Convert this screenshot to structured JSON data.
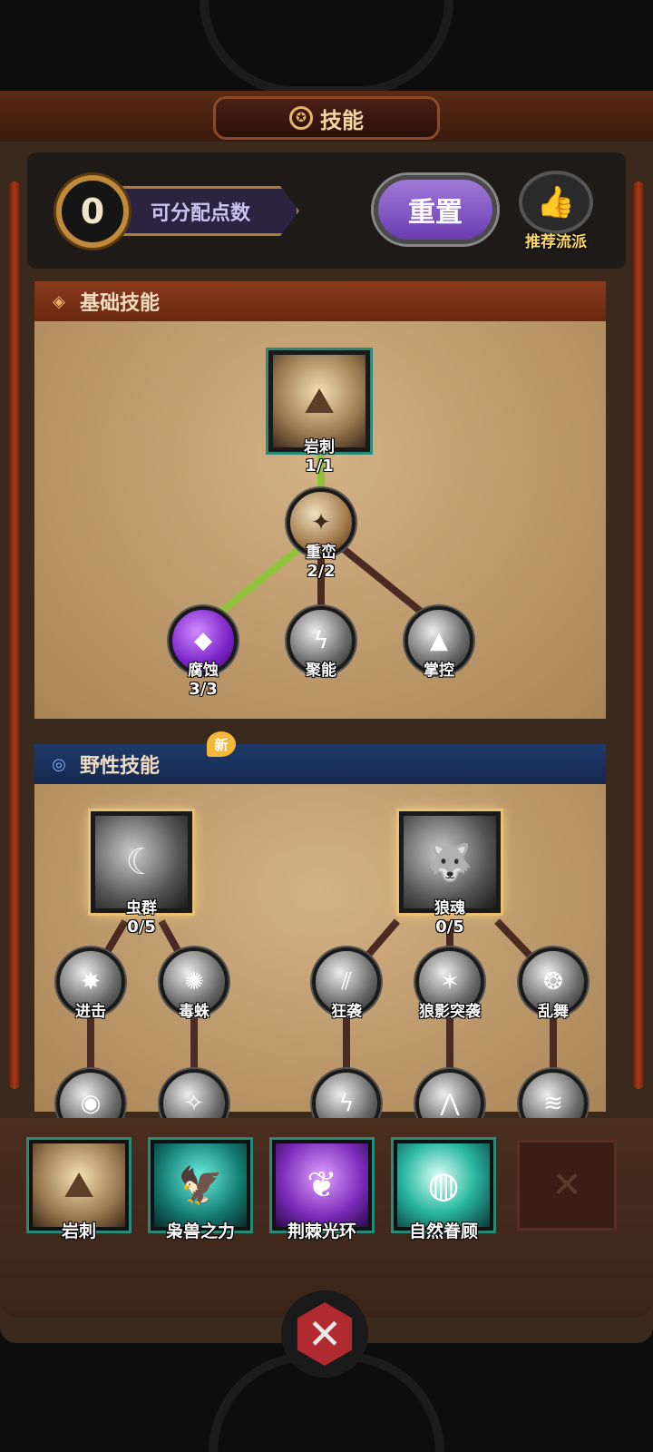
{
  "header": {
    "title": "技能",
    "title_icon": "pentagram-icon"
  },
  "points": {
    "value": "0",
    "label": "可分配点数"
  },
  "reset_button": {
    "label": "重置"
  },
  "recommend": {
    "label": "推荐流派",
    "icon": "thumbs-up-icon"
  },
  "basic_section": {
    "title": "基础技能",
    "nodes": [
      {
        "name": "岩刺",
        "level": "1/1"
      },
      {
        "name": "重峦",
        "level": "2/2"
      },
      {
        "name": "腐蚀",
        "level": "3/3"
      },
      {
        "name": "聚能",
        "level": ""
      },
      {
        "name": "掌控",
        "level": ""
      }
    ]
  },
  "wild_section": {
    "title": "野性技能",
    "new_badge": "新",
    "roots": [
      {
        "name": "虫群",
        "level": "0/5"
      },
      {
        "name": "狼魂",
        "level": "0/5"
      }
    ],
    "children": [
      {
        "name": "进击"
      },
      {
        "name": "毒蛛"
      },
      {
        "name": "狂袭"
      },
      {
        "name": "狼影突袭"
      },
      {
        "name": "乱舞"
      }
    ]
  },
  "equipped": [
    {
      "name": "岩刺"
    },
    {
      "name": "枭兽之力"
    },
    {
      "name": "荆棘光环"
    },
    {
      "name": "自然眷顾"
    },
    {
      "name": ""
    }
  ],
  "colors": {
    "accent_green": "#8fc43a",
    "path_dark": "#4a2a22",
    "wild_header": "#1f3a6a",
    "basic_header": "#8a3a1c"
  }
}
